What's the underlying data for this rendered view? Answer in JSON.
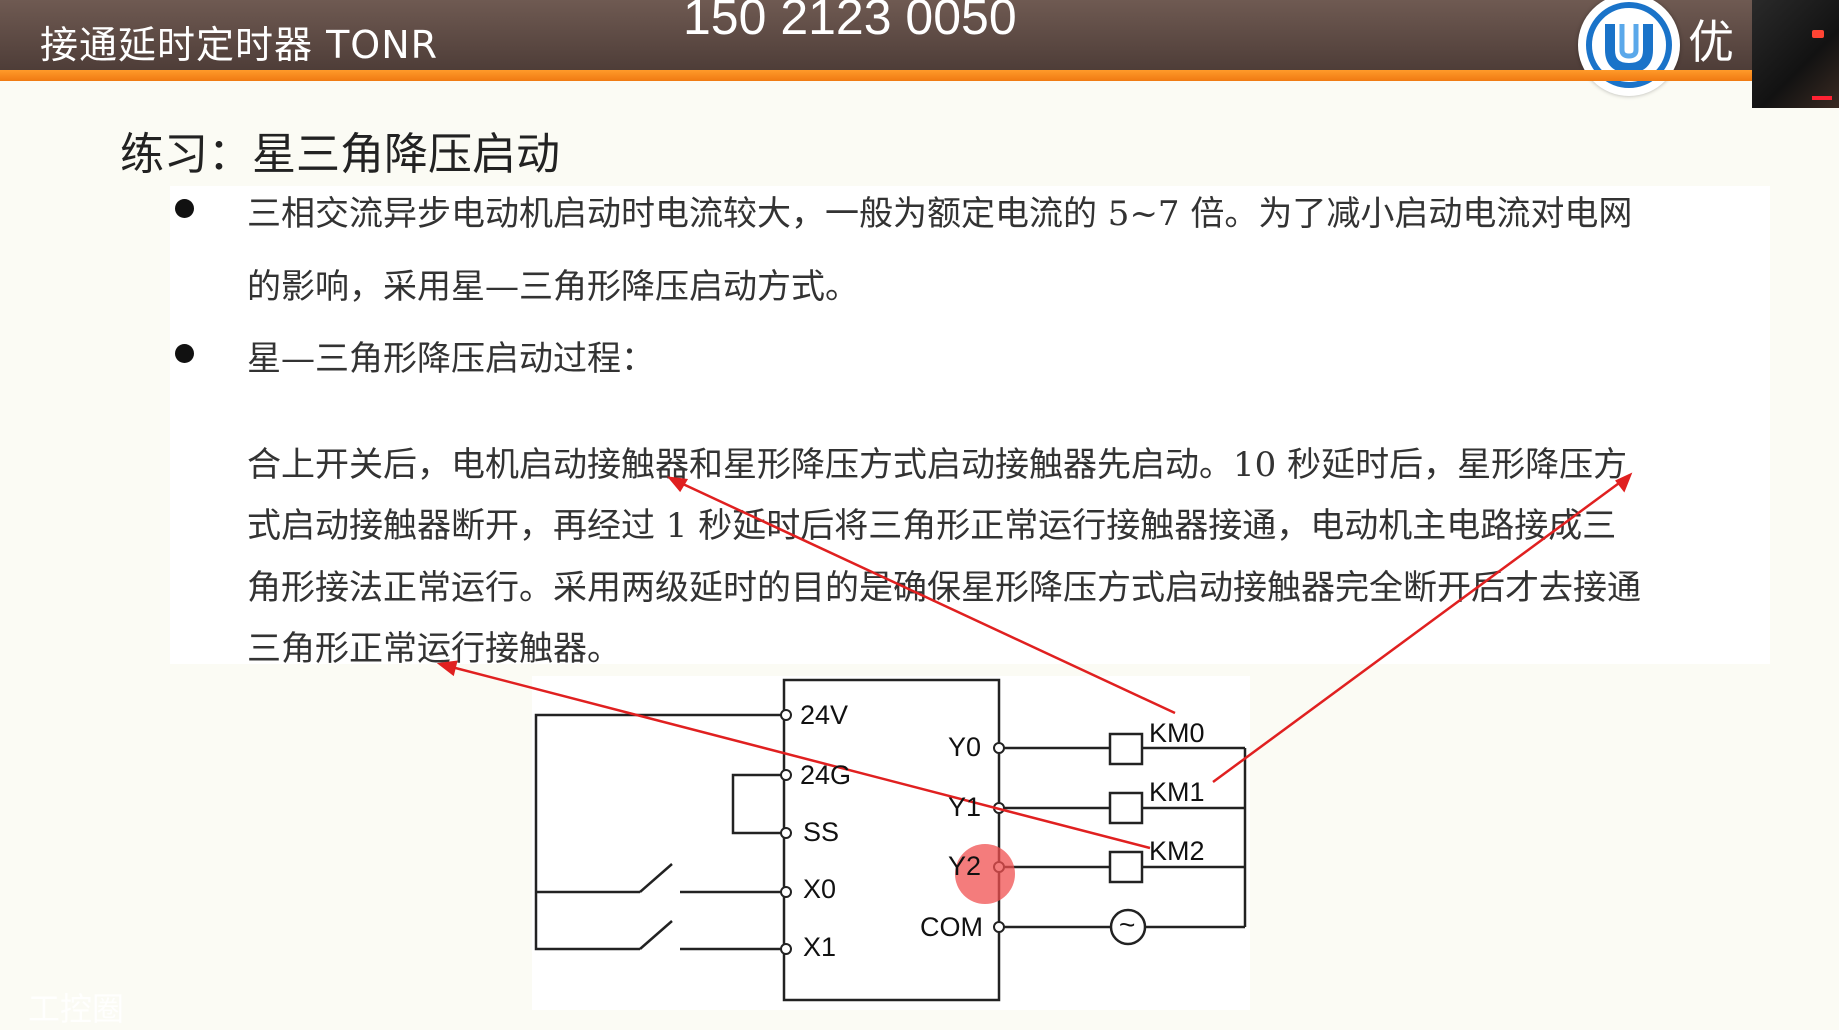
{
  "header": {
    "title": "接通延时定时器  TONR",
    "phone": "150 2123 0050",
    "logo_text": "优",
    "colors": {
      "bar": "#4e3d38",
      "accent": "#f07a12",
      "logo": "#1a73c9"
    }
  },
  "slide": {
    "section_title": "练习：星三角降压启动",
    "bullet1": {
      "line1": "三相交流异步电动机启动时电流较大，一般为额定电流的 5~7 倍。为了减小启动电流对电网",
      "line2": "的影响，采用星—三角形降压启动方式。"
    },
    "bullet2": {
      "heading": "星—三角形降压启动过程：",
      "line1": "合上开关后，电机启动接触器和星形降压方式启动接触器先启动。10 秒延时后，星形降压方",
      "line2": "式启动接触器断开，再经过 1 秒延时后将三角形正常运行接触器接通，电动机主电路接成三",
      "line3": "角形接法正常运行。采用两级延时的目的是确保星形降压方式启动接触器完全断开后才去接通",
      "line4": "三角形正常运行接触器。"
    }
  },
  "diagram": {
    "left_terminals": [
      "24V",
      "24G",
      "SS",
      "X0",
      "X1"
    ],
    "right_terminals": [
      "Y0",
      "Y1",
      "Y2",
      "COM"
    ],
    "loads": [
      "KM0",
      "KM1",
      "KM2"
    ],
    "source_symbol": "~",
    "annotation_color": "#e02020"
  },
  "overlay": {
    "watermark": "工控圈"
  }
}
